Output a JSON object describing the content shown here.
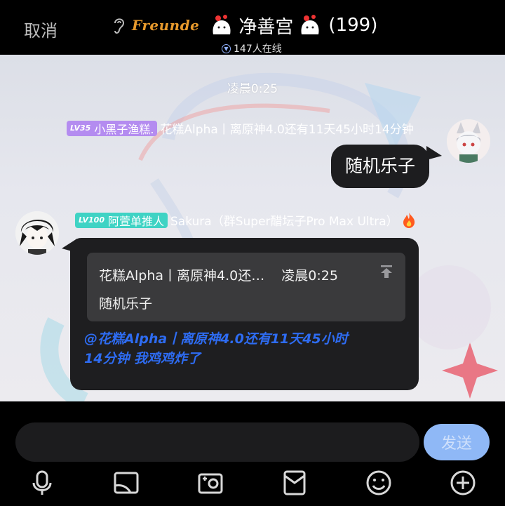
{
  "header": {
    "cancel_label": "取消",
    "brand_logo_text": "Freunde",
    "group_name": "净善宫",
    "member_count": "(199)",
    "online_text": "147人在线"
  },
  "chat": {
    "timestamp": "凌晨0:25",
    "message1": {
      "badge_level": "LV35",
      "badge_title": "小黑子渔糕.",
      "sender_name": "花糕Alpha丨离原神4.0还有11天45小时14分钟",
      "text": "随机乐子"
    },
    "message2": {
      "badge_level": "LV100",
      "badge_title": "阿萱单推人",
      "sender_name": "Sakura（群Super醋坛子Pro Max Ultra）",
      "quote_sender": "花糕Alpha丨离原神4.0还…",
      "quote_time": "凌晨0:25",
      "quote_text": "随机乐子",
      "mention_text": "@花糕Alpha丨离原神4.0还有11天45小时14分钟 我鸡鸡炸了"
    }
  },
  "input": {
    "value": "",
    "send_label": "发送"
  },
  "toolbar": {
    "icons": [
      "microphone-icon",
      "image-icon",
      "camera-icon",
      "red-packet-icon",
      "emoji-icon",
      "plus-icon"
    ]
  },
  "colors": {
    "accent_blue": "#2e6cf2",
    "send_button": "#8fb8f6",
    "badge_purple": "#b48cf0",
    "badge_teal": "#3fd3c4"
  }
}
